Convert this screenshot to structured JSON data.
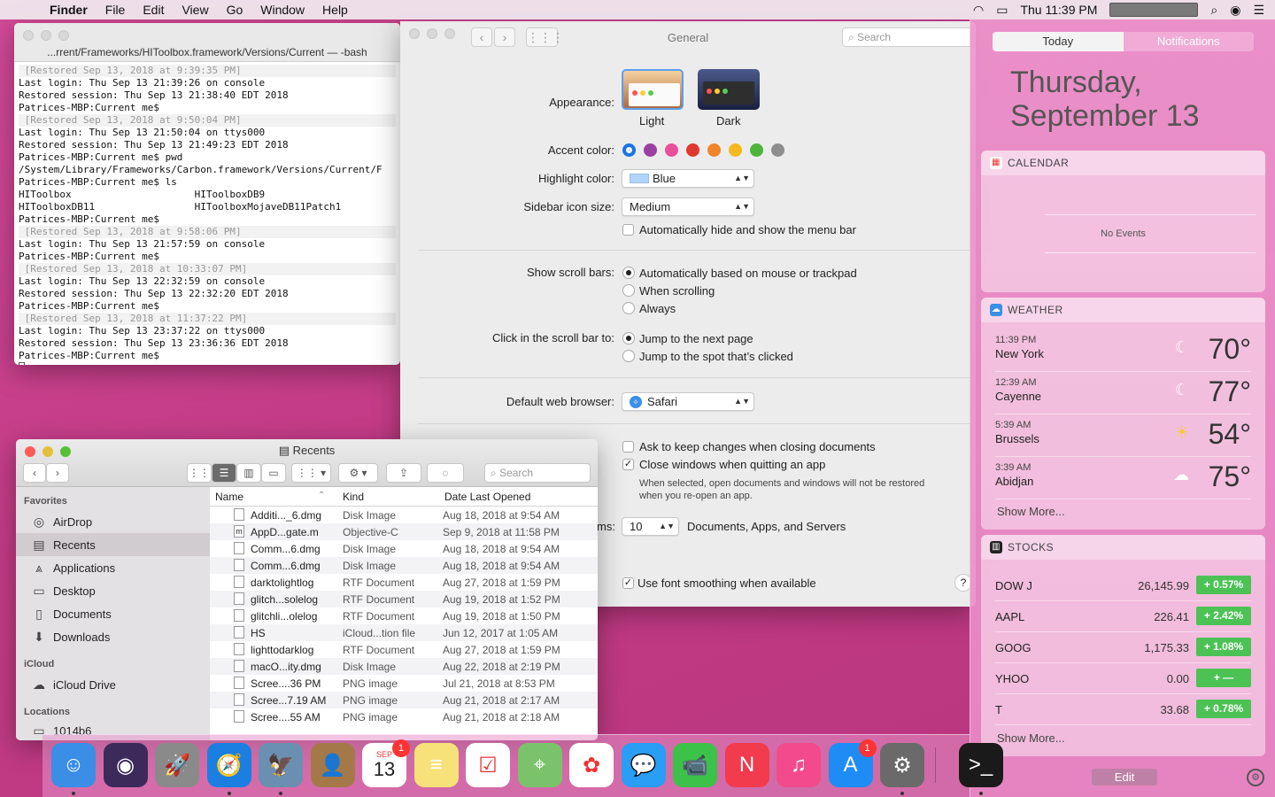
{
  "menubar": {
    "app": "Finder",
    "items": [
      "File",
      "Edit",
      "View",
      "Go",
      "Window",
      "Help"
    ],
    "clock": "Thu 11:39 PM"
  },
  "terminal": {
    "title": "...rrent/Frameworks/HIToolbox.framework/Versions/Current — -bash",
    "lines": [
      {
        "t": " [Restored Sep 13, 2018 at 9:39:35 PM]",
        "r": true
      },
      {
        "t": "Last login: Thu Sep 13 21:39:26 on console"
      },
      {
        "t": "Restored session: Thu Sep 13 21:38:40 EDT 2018"
      },
      {
        "t": "Patrices-MBP:Current me$"
      },
      {
        "t": " [Restored Sep 13, 2018 at 9:50:04 PM]",
        "r": true
      },
      {
        "t": "Last login: Thu Sep 13 21:50:04 on ttys000"
      },
      {
        "t": "Restored session: Thu Sep 13 21:49:23 EDT 2018"
      },
      {
        "t": "Patrices-MBP:Current me$ pwd"
      },
      {
        "t": "/System/Library/Frameworks/Carbon.framework/Versions/Current/F"
      },
      {
        "t": "Patrices-MBP:Current me$ ls"
      },
      {
        "t": "HIToolbox                     HIToolboxDB9"
      },
      {
        "t": "HIToolboxDB11                 HIToolboxMojaveDB11Patch1"
      },
      {
        "t": "Patrices-MBP:Current me$"
      },
      {
        "t": " [Restored Sep 13, 2018 at 9:58:06 PM]",
        "r": true
      },
      {
        "t": "Last login: Thu Sep 13 21:57:59 on console"
      },
      {
        "t": "Patrices-MBP:Current me$"
      },
      {
        "t": " [Restored Sep 13, 2018 at 10:33:07 PM]",
        "r": true
      },
      {
        "t": "Last login: Thu Sep 13 22:32:59 on console"
      },
      {
        "t": "Restored session: Thu Sep 13 22:32:20 EDT 2018"
      },
      {
        "t": "Patrices-MBP:Current me$"
      },
      {
        "t": " [Restored Sep 13, 2018 at 11:37:22 PM]",
        "r": true
      },
      {
        "t": "Last login: Thu Sep 13 23:37:22 on ttys000"
      },
      {
        "t": "Restored session: Thu Sep 13 23:36:36 EDT 2018"
      },
      {
        "t": "Patrices-MBP:Current me$ "
      }
    ]
  },
  "prefs": {
    "title": "General",
    "search_placeholder": "Search",
    "appearance_label": "Appearance:",
    "light": "Light",
    "dark": "Dark",
    "accent_label": "Accent color:",
    "accent_colors": [
      "#1a73e8",
      "#9b3fa4",
      "#ea4f9a",
      "#e0382f",
      "#f0852a",
      "#f5b81f",
      "#4fb43c",
      "#8e8e8e"
    ],
    "highlight_label": "Highlight color:",
    "highlight_value": "Blue",
    "sidebar_label": "Sidebar icon size:",
    "sidebar_value": "Medium",
    "autohide": "Automatically hide and show the menu bar",
    "scroll_label": "Show scroll bars:",
    "scroll_opts": [
      "Automatically based on mouse or trackpad",
      "When scrolling",
      "Always"
    ],
    "click_label": "Click in the scroll bar to:",
    "click_opts": [
      "Jump to the next page",
      "Jump to the spot that’s clicked"
    ],
    "browser_label": "Default web browser:",
    "browser_value": "Safari",
    "ask_keep": "Ask to keep changes when closing documents",
    "close_windows": "Close windows when quitting an app",
    "close_note_1": "When selected, open documents and windows will not be restored",
    "close_note_2": "when you re-open an app.",
    "recent_label_fragment": "ms:",
    "recent_value": "10",
    "recent_text": "Documents, Apps, and Servers",
    "font_smoothing": "Use font smoothing when available",
    "help": "?"
  },
  "finder": {
    "title": "Recents",
    "search_placeholder": "Search",
    "favorites_label": "Favorites",
    "favorites": [
      {
        "label": "AirDrop",
        "icon": "airdrop-icon",
        "glyph": "◎"
      },
      {
        "label": "Recents",
        "icon": "recents-icon",
        "glyph": "▤"
      },
      {
        "label": "Applications",
        "icon": "applications-icon",
        "glyph": "⩓"
      },
      {
        "label": "Desktop",
        "icon": "desktop-icon",
        "glyph": "▭"
      },
      {
        "label": "Documents",
        "icon": "documents-icon",
        "glyph": "▯"
      },
      {
        "label": "Downloads",
        "icon": "downloads-icon",
        "glyph": "⬇"
      }
    ],
    "icloud_label": "iCloud",
    "icloud_drive": "iCloud Drive",
    "locations_label": "Locations",
    "location_item": "1014b6",
    "columns": {
      "name": "Name",
      "kind": "Kind",
      "date": "Date Last Opened"
    },
    "rows": [
      {
        "name": "Additi..._6.dmg",
        "kind": "Disk Image",
        "date": "Aug 18, 2018 at 9:54 AM",
        "g": ""
      },
      {
        "name": "AppD...gate.m",
        "kind": "Objective-C",
        "date": "Sep 9, 2018 at 11:58 PM",
        "g": "m"
      },
      {
        "name": "Comm...6.dmg",
        "kind": "Disk Image",
        "date": "Aug 18, 2018 at 9:54 AM",
        "g": ""
      },
      {
        "name": "Comm...6.dmg",
        "kind": "Disk Image",
        "date": "Aug 18, 2018 at 9:54 AM",
        "g": ""
      },
      {
        "name": "darktolightlog",
        "kind": "RTF Document",
        "date": "Aug 27, 2018 at 1:59 PM",
        "g": ""
      },
      {
        "name": "glitch...solelog",
        "kind": "RTF Document",
        "date": "Aug 19, 2018 at 1:52 PM",
        "g": ""
      },
      {
        "name": "glitchli...olelog",
        "kind": "RTF Document",
        "date": "Aug 19, 2018 at 1:50 PM",
        "g": ""
      },
      {
        "name": "HS",
        "kind": "iCloud...tion file",
        "date": "Jun 12, 2017 at 1:05 AM",
        "g": ""
      },
      {
        "name": "lighttodarklog",
        "kind": "RTF Document",
        "date": "Aug 27, 2018 at 1:59 PM",
        "g": ""
      },
      {
        "name": "macO...ity.dmg",
        "kind": "Disk Image",
        "date": "Aug 22, 2018 at 2:19 PM",
        "g": ""
      },
      {
        "name": "Scree....36 PM",
        "kind": "PNG image",
        "date": "Jul 21, 2018 at 8:53 PM",
        "g": ""
      },
      {
        "name": "Scree...7.19 AM",
        "kind": "PNG image",
        "date": "Aug 21, 2018 at 2:17 AM",
        "g": ""
      },
      {
        "name": "Scree....55 AM",
        "kind": "PNG image",
        "date": "Aug 21, 2018 at 2:18 AM",
        "g": ""
      }
    ]
  },
  "nc": {
    "tab_today": "Today",
    "tab_notifications": "Notifications",
    "date_line1": "Thursday,",
    "date_line2": "September 13",
    "calendar_title": "CALENDAR",
    "no_events": "No Events",
    "weather_title": "WEATHER",
    "weather": [
      {
        "time": "11:39 PM",
        "city": "New York",
        "temp": "70°",
        "glyph": "☾"
      },
      {
        "time": "12:39 AM",
        "city": "Cayenne",
        "temp": "77°",
        "glyph": "☾"
      },
      {
        "time": "5:39 AM",
        "city": "Brussels",
        "temp": "54°",
        "glyph": "☀"
      },
      {
        "time": "3:39 AM",
        "city": "Abidjan",
        "temp": "75°",
        "glyph": "☁"
      }
    ],
    "show_more": "Show More...",
    "stocks_title": "STOCKS",
    "stocks": [
      {
        "sym": "DOW J",
        "val": "26,145.99",
        "chg": "+ 0.57%"
      },
      {
        "sym": "AAPL",
        "val": "226.41",
        "chg": "+ 2.42%"
      },
      {
        "sym": "GOOG",
        "val": "1,175.33",
        "chg": "+ 1.08%"
      },
      {
        "sym": "YHOO",
        "val": "0.00",
        "chg": "+    —"
      },
      {
        "sym": "T",
        "val": "33.68",
        "chg": "+ 0.78%"
      }
    ],
    "edit": "Edit"
  },
  "dock": {
    "calendar_month": "SEP",
    "calendar_day": "13",
    "calendar_badge": "1",
    "appstore_badge": "1",
    "apps": [
      {
        "name": "finder-icon",
        "bg": "#3a8ee6",
        "glyph": "☺"
      },
      {
        "name": "siri-icon",
        "bg": "#3b2a5a",
        "glyph": "◉"
      },
      {
        "name": "launchpad-icon",
        "bg": "#8a8a8a",
        "glyph": "🚀"
      },
      {
        "name": "safari-icon",
        "bg": "#1a7fe0",
        "glyph": "🧭"
      },
      {
        "name": "preview-icon",
        "bg": "#6b8fb0",
        "glyph": "🦅"
      },
      {
        "name": "contacts-icon",
        "bg": "#a47848",
        "glyph": "👤"
      },
      {
        "name": "calendar-icon",
        "bg": "#ffffff",
        "glyph": ""
      },
      {
        "name": "notes-icon",
        "bg": "#f7e27a",
        "glyph": "≡"
      },
      {
        "name": "reminders-icon",
        "bg": "#ffffff",
        "glyph": "☑"
      },
      {
        "name": "maps-icon",
        "bg": "#7bc36b",
        "glyph": "⌖"
      },
      {
        "name": "photos-icon",
        "bg": "#ffffff",
        "glyph": "✿"
      },
      {
        "name": "messages-icon",
        "bg": "#2a9df4",
        "glyph": "💬"
      },
      {
        "name": "facetime-icon",
        "bg": "#3cc249",
        "glyph": "📹"
      },
      {
        "name": "news-icon",
        "bg": "#f23b4c",
        "glyph": "N"
      },
      {
        "name": "music-icon",
        "bg": "#f24a8a",
        "glyph": "♫"
      },
      {
        "name": "app-store-icon",
        "bg": "#1f8cf5",
        "glyph": "A"
      },
      {
        "name": "system-preferences-icon",
        "bg": "#6a6a6a",
        "glyph": "⚙"
      },
      {
        "name": "terminal-icon",
        "bg": "#1a1a1a",
        "glyph": ">_"
      }
    ]
  }
}
